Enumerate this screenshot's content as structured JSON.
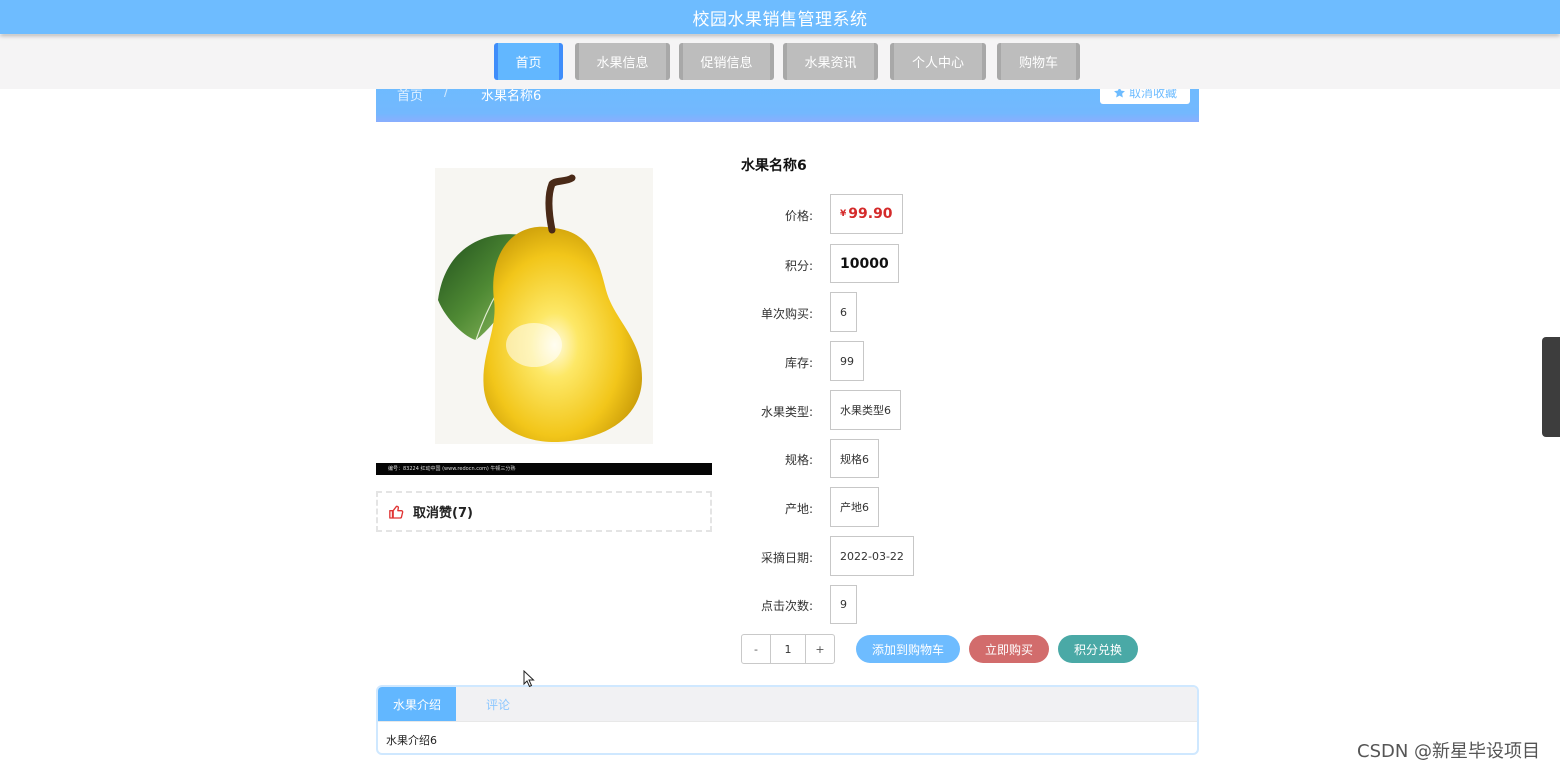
{
  "header": {
    "title": "校园水果销售管理系统"
  },
  "nav": {
    "items": [
      {
        "label": "首页",
        "active": true
      },
      {
        "label": "水果信息"
      },
      {
        "label": "促销信息"
      },
      {
        "label": "水果资讯"
      },
      {
        "label": "个人中心"
      },
      {
        "label": "购物车"
      }
    ]
  },
  "breadcrumb": {
    "home": "首页",
    "separator": "/",
    "current": "水果名称6"
  },
  "favorite": {
    "label": "取消收藏",
    "icon": "star-icon"
  },
  "product": {
    "image_caption": "编号：83224    红动中国 (www.redocn.com)  牛顿三分熟",
    "like_label": "取消赞(7)",
    "name": "水果名称6",
    "fields": {
      "price_label": "价格:",
      "price_currency": "¥",
      "price_value": "99.90",
      "points_label": "积分:",
      "points_value": "10000",
      "per_purchase_label": "单次购买:",
      "per_purchase_value": "6",
      "stock_label": "库存:",
      "stock_value": "99",
      "type_label": "水果类型:",
      "type_value": "水果类型6",
      "spec_label": "规格:",
      "spec_value": "规格6",
      "origin_label": "产地:",
      "origin_value": "产地6",
      "pick_date_label": "采摘日期:",
      "pick_date_value": "2022-03-22",
      "clicks_label": "点击次数:",
      "clicks_value": "9"
    },
    "quantity": {
      "minus": "-",
      "value": "1",
      "plus": "+"
    },
    "actions": {
      "add_to_cart": "添加到购物车",
      "buy_now": "立即购买",
      "points_exchange": "积分兑换"
    }
  },
  "tabs": {
    "intro_label": "水果介绍",
    "comments_label": "评论",
    "intro_content": "水果介绍6"
  },
  "colors": {
    "primary": "#6ebcff",
    "price": "#d42a2a",
    "add_to_cart": "#6ebcff",
    "buy_now": "#d26c6c",
    "exchange": "#4aa9a6"
  },
  "watermark": "CSDN @新星毕设项目"
}
